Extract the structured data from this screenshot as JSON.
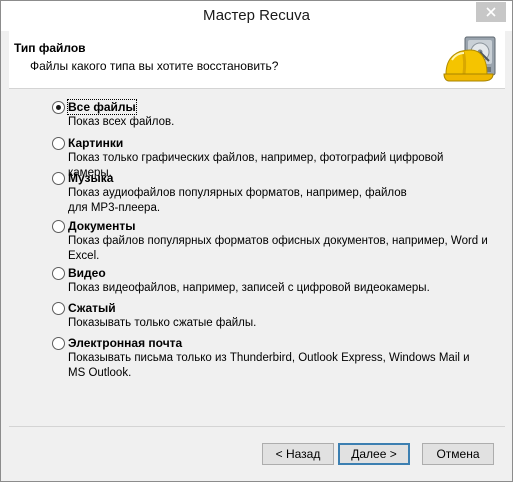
{
  "window": {
    "title": "Мастер Recuva"
  },
  "header": {
    "title": "Тип файлов",
    "subtitle": "Файлы какого типа вы хотите восстановить?",
    "logo_icon": "recuva-hardhat-drive-icon"
  },
  "options": [
    {
      "label": "Все файлы",
      "desc": "Показ всех файлов.",
      "checked": true
    },
    {
      "label": "Картинки",
      "desc": "Показ только графических файлов, например, фотографий цифровой камеры.",
      "checked": false
    },
    {
      "label": "Музыка",
      "desc": "Показ аудиофайлов популярных форматов, например, файлов для MP3-плеера.",
      "checked": false
    },
    {
      "label": "Документы",
      "desc": "Показ файлов популярных форматов офисных документов, например, Word и Excel.",
      "checked": false
    },
    {
      "label": "Видео",
      "desc": "Показ видеофайлов, например, записей с цифровой видеокамеры.",
      "checked": false
    },
    {
      "label": "Сжатый",
      "desc": "Показывать только сжатые файлы.",
      "checked": false
    },
    {
      "label": "Электронная почта",
      "desc": "Показывать письма только из Thunderbird, Outlook Express, Windows Mail и MS Outlook.",
      "checked": false
    }
  ],
  "buttons": {
    "back": "< Назад",
    "next": "Далее >",
    "cancel": "Отмена"
  },
  "colors": {
    "close_button": "#c7c7c7",
    "default_button_border": "#3c7fb1",
    "window_bg": "#f0f0f0"
  }
}
